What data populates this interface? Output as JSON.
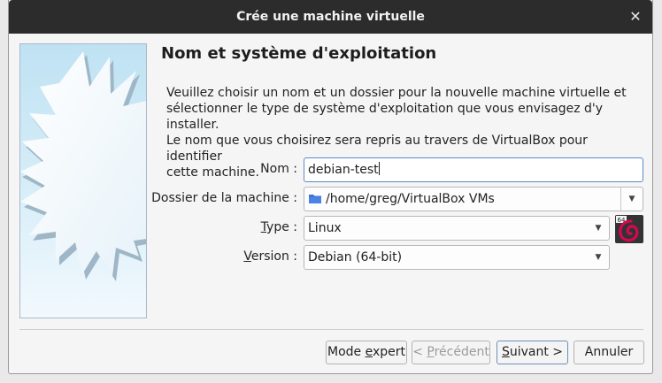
{
  "window": {
    "title": "Crée une machine virtuelle"
  },
  "page": {
    "heading": "Nom et système d'exploitation",
    "description": [
      "Veuillez choisir un nom et un dossier pour la nouvelle machine virtuelle et",
      "sélectionner le type de système d'exploitation que vous envisagez d'y installer.",
      "Le nom que vous choisirez sera repris au travers de VirtualBox pour identifier",
      "cette machine."
    ]
  },
  "form": {
    "name_label": "Nom :",
    "name_value": "debian-test",
    "folder_label": "Dossier de la machine :",
    "folder_value": "/home/greg/VirtualBox VMs",
    "type_label_u": "T",
    "type_label_rest": "ype :",
    "type_value": "Linux",
    "version_label_u": "V",
    "version_label_rest": "ersion :",
    "version_value": "Debian (64-bit)",
    "os_icon_badge": "64"
  },
  "buttons": {
    "expert_pre": "Mode ",
    "expert_u": "e",
    "expert_post": "xpert",
    "back_pre": "< ",
    "back_u": "P",
    "back_post": "récédent",
    "next_u": "S",
    "next_post": "uivant >",
    "cancel": "Annuler"
  },
  "colors": {
    "titlebar": "#2c2c2c",
    "folder_icon": "#3b6fd4",
    "debian_red": "#d70751",
    "focus_border": "#5b8bc8"
  },
  "icons": {
    "close": "close-icon",
    "folder": "folder-icon",
    "dropdown": "chevron-down-icon",
    "os": "debian-64-icon"
  }
}
